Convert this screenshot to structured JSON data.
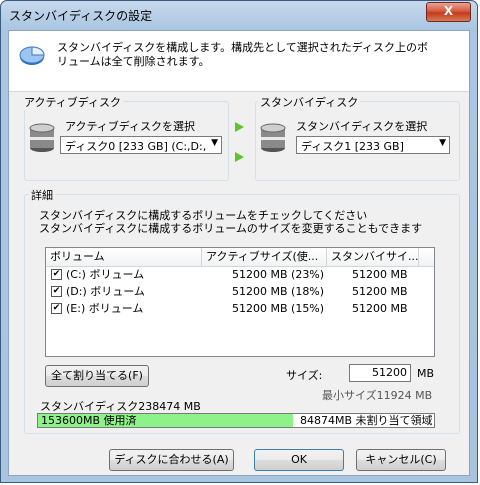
{
  "window": {
    "title": "スタンバイディスクの設定",
    "close_label": "X"
  },
  "banner": {
    "line1": "スタンバイディスクを構成します。構成先として選択されたディスク上のボ",
    "line2": "リュームは全て削除されます。"
  },
  "active": {
    "group_label": "アクティブディスク",
    "select_label": "アクティブディスクを選択",
    "selected": "ディスク0 [233 GB] (C:,D:,"
  },
  "standby": {
    "group_label": "スタンバイディスク",
    "select_label": "スタンバイディスクを選択",
    "selected": "ディスク1 [233 GB]"
  },
  "details": {
    "group_label": "詳細",
    "instruction1": "スタンバイディスクに構成するボリュームをチェックしてください",
    "instruction2": "スタンバイディスクに構成するボリュームのサイズを変更することもできます",
    "columns": [
      "ボリューム",
      "アクティブサイズ(使...",
      "スタンバイサイ..."
    ],
    "rows": [
      {
        "checked": "✔",
        "volume": "(C:) ボリューム",
        "active": "51200 MB (23%)",
        "standby": "51200 MB"
      },
      {
        "checked": "✔",
        "volume": "(D:) ボリューム",
        "active": "51200 MB (18%)",
        "standby": "51200 MB"
      },
      {
        "checked": "✔",
        "volume": "(E:) ボリューム",
        "active": "51200 MB (15%)",
        "standby": "51200 MB"
      }
    ],
    "assign_all_label": "全て割り当てる(F)",
    "size_label": "サイズ:",
    "size_value": "51200",
    "size_unit": "MB",
    "min_size": "最小サイズ11924 MB",
    "standby_total": "スタンバイディスク238474 MB",
    "used_text": "153600MB 使用済",
    "unallocated_text": "84874MB 未割り当て領域",
    "used_fraction": 0.644
  },
  "buttons": {
    "fit": "ディスクに合わせる(A)",
    "ok": "OK",
    "cancel": "キャンセル(C)"
  },
  "colors": {
    "used_bar": "#8ef28a",
    "arrow": "#5cc42e"
  }
}
